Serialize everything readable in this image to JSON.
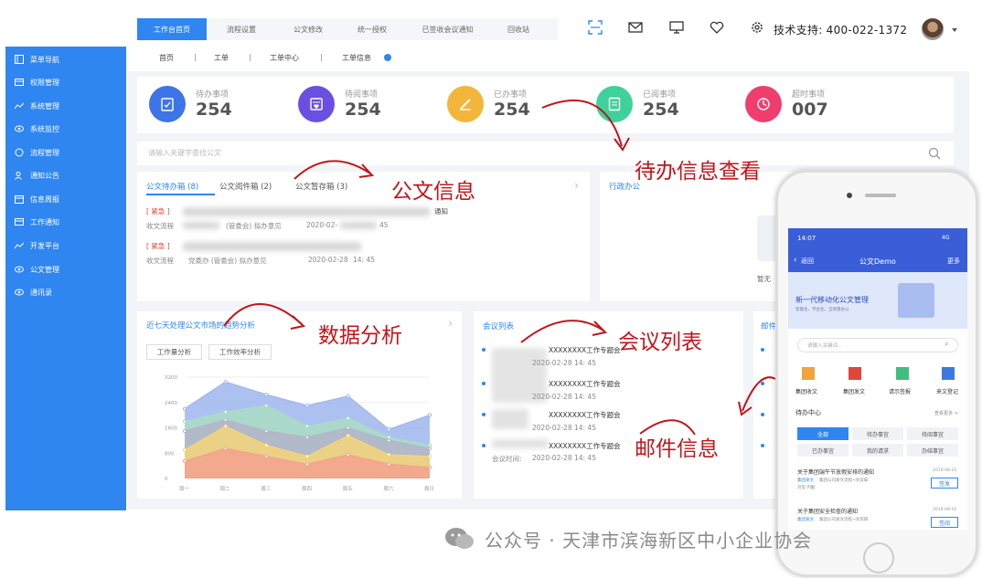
{
  "sidebar": {
    "items": [
      {
        "label": "菜单导航",
        "icon": "menu-icon"
      },
      {
        "label": "权限管理",
        "icon": "card-icon"
      },
      {
        "label": "系统管理",
        "icon": "trend-icon"
      },
      {
        "label": "系统监控",
        "icon": "eye-icon"
      },
      {
        "label": "流程管理",
        "icon": "chat-icon"
      },
      {
        "label": "通知公告",
        "icon": "users-icon"
      },
      {
        "label": "信息周报",
        "icon": "calendar-icon"
      },
      {
        "label": "工作通知",
        "icon": "card-icon"
      },
      {
        "label": "开发平台",
        "icon": "trend-icon"
      },
      {
        "label": "公文管理",
        "icon": "eye-icon"
      },
      {
        "label": "通讯录",
        "icon": "eye-icon"
      }
    ]
  },
  "topnav": {
    "tabs": [
      "工作台首页",
      "流程设置",
      "公文修改",
      "统一授权",
      "已签收会议通知",
      "回收站"
    ],
    "support": "技术支持: 400-022-1372"
  },
  "breadcrumb": [
    "首页",
    "工单",
    "工单中心",
    "工单信息"
  ],
  "stats": [
    {
      "label": "待办事项",
      "value": "254",
      "color": "#3d74e8"
    },
    {
      "label": "待阅事项",
      "value": "254",
      "color": "#6a4fe0"
    },
    {
      "label": "已办事项",
      "value": "254",
      "color": "#f3b53a"
    },
    {
      "label": "已阅事项",
      "value": "254",
      "color": "#3fd19a"
    },
    {
      "label": "超时事项",
      "value": "007",
      "color": "#ef3e6d"
    }
  ],
  "search": {
    "placeholder": "请输入关键字查找公文"
  },
  "doc_panel": {
    "tabs": [
      "公文待办箱 (8)",
      "公文阅件箱 (2)",
      "公文暂存箱 (3)"
    ],
    "items": [
      {
        "tag": "[ 紧急 ]",
        "suffix": "通知",
        "meta_a": "收文流程",
        "meta_b": "(管委会) 拟办意见",
        "date": "2020-02-",
        "time": "45"
      },
      {
        "tag": "[ 紧急 ]",
        "suffix": "",
        "meta_a": "收文流程",
        "meta_b": "党委办  (管委会) 拟办意见",
        "date": "2020-02-28",
        "time": "14: 45"
      }
    ]
  },
  "admin_panel": {
    "title": "行政办公",
    "empty": "暂无"
  },
  "chart_panel": {
    "title": "近七天处理公文市场的趋势分析",
    "btn1": "工作量分析",
    "btn2": "工作效率分析"
  },
  "meeting_panel": {
    "title": "会议列表",
    "items": [
      {
        "title": "XXXXXXXX工作专题会",
        "time": "2020-02-28  14: 45"
      },
      {
        "title": "XXXXXXXX工作专题会",
        "time": "2020-02-28  14: 45"
      },
      {
        "title": "XXXXXXXX工作专题会",
        "time": "2020-02-28  14: 45"
      },
      {
        "title": "XXXXXXXX工作专题会",
        "time": "2020-02-28  14: 45"
      }
    ],
    "time_label": "会议时间:"
  },
  "mail_panel": {
    "title": "邮件"
  },
  "annotations": {
    "doc": "公文信息",
    "todo": "待办信息查看",
    "data": "数据分析",
    "meeting": "会议列表",
    "mail": "邮件信息"
  },
  "watermark": "公众号 · 天津市滨海新区中小企业协会",
  "phone": {
    "time": "14:07",
    "signal": "4G",
    "back": "返回",
    "title": "公文Demo",
    "more": "更多",
    "banner_title": "新一代移动化公文管理",
    "banner_sub": "智能化、平台化、全场景办公",
    "search_placeholder": "请输入关键词...",
    "apps": [
      "集团收文",
      "集团发文",
      "请示签报",
      "来文登记"
    ],
    "todo_title": "待办中心",
    "todo_more": "查看更多 >",
    "filters": [
      "全部",
      "待办事宜",
      "待阅事宜",
      "已办事宜",
      "我的请求",
      "办结事宜"
    ],
    "items": [
      {
        "title": "关于集团端午节放假安排的通知",
        "date": "2019-08-16",
        "tag": "集团发文",
        "desc": "集团公司发文流程→文双辞",
        "desc2": "刘莹 内勤",
        "btn": "签发"
      },
      {
        "title": "关于集团安全检查的通知",
        "date": "2019-08-16",
        "tag": "集团发文",
        "desc": "集团公司发文流程→文双辞",
        "btn": "签阅"
      }
    ]
  },
  "chart_data": {
    "type": "area",
    "categories": [
      "周一",
      "周二",
      "周三",
      "周四",
      "周五",
      "周六",
      "周日"
    ],
    "yticks": [
      "3200",
      "2400",
      "1600",
      "800",
      "0"
    ],
    "ylim": [
      0,
      3200
    ],
    "series": [
      {
        "color": "#9fb6ee",
        "values": [
          2200,
          3050,
          2650,
          2300,
          2600,
          1550,
          2000
        ]
      },
      {
        "color": "#a9dcc4",
        "values": [
          1800,
          2100,
          2300,
          1650,
          1900,
          1300,
          1050
        ]
      },
      {
        "color": "#b4b4c8",
        "values": [
          1500,
          1850,
          1500,
          1300,
          1600,
          1200,
          950
        ]
      },
      {
        "color": "#f5d57a",
        "values": [
          900,
          1650,
          1050,
          700,
          1350,
          750,
          700
        ]
      },
      {
        "color": "#f3a28e",
        "values": [
          550,
          950,
          700,
          450,
          750,
          450,
          350
        ]
      }
    ]
  }
}
